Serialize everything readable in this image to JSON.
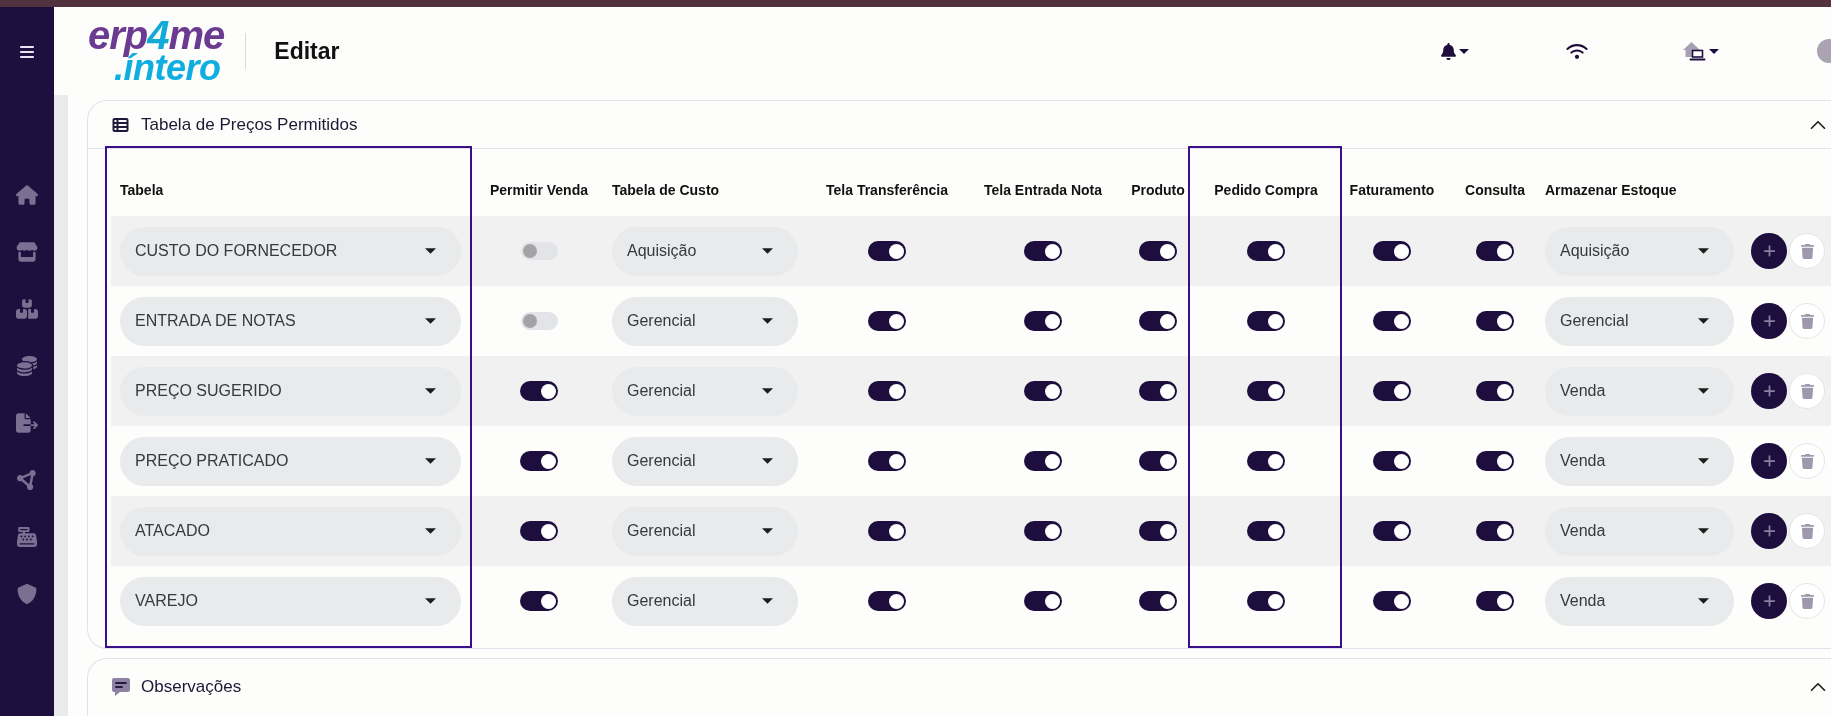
{
  "header": {
    "logo": {
      "word": "erp",
      "digit": "4",
      "suffix": "me",
      "tagline": ".íntero"
    },
    "title": "Editar"
  },
  "price_tables": {
    "title": "Tabela de Preços Permitidos",
    "expanded": true,
    "columns": [
      {
        "label": "Tabela",
        "kind": "select",
        "highlighted": true
      },
      {
        "label": "Permitir Venda",
        "kind": "toggle",
        "highlighted": false
      },
      {
        "label": "Tabela de Custo",
        "kind": "select",
        "highlighted": false
      },
      {
        "label": "Tela Transferência",
        "kind": "toggle",
        "highlighted": false
      },
      {
        "label": "Tela Entrada Nota",
        "kind": "toggle",
        "highlighted": false
      },
      {
        "label": "Produto",
        "kind": "toggle",
        "highlighted": false
      },
      {
        "label": "Pedido Compra",
        "kind": "toggle",
        "highlighted": true
      },
      {
        "label": "Faturamento",
        "kind": "toggle",
        "highlighted": false
      },
      {
        "label": "Consulta",
        "kind": "toggle",
        "highlighted": false
      },
      {
        "label": "Armazenar Estoque",
        "kind": "select",
        "highlighted": false
      }
    ],
    "rows": [
      {
        "cells": [
          {
            "value": "CUSTO DO FORNECEDOR"
          },
          {
            "on": false
          },
          {
            "value": "Aquisição"
          },
          {
            "on": true
          },
          {
            "on": true
          },
          {
            "on": true
          },
          {
            "on": true
          },
          {
            "on": true
          },
          {
            "on": true
          },
          {
            "value": "Aquisição"
          }
        ]
      },
      {
        "cells": [
          {
            "value": "ENTRADA DE NOTAS"
          },
          {
            "on": false
          },
          {
            "value": "Gerencial"
          },
          {
            "on": true
          },
          {
            "on": true
          },
          {
            "on": true
          },
          {
            "on": true
          },
          {
            "on": true
          },
          {
            "on": true
          },
          {
            "value": "Gerencial"
          }
        ]
      },
      {
        "cells": [
          {
            "value": "PREÇO SUGERIDO"
          },
          {
            "on": true
          },
          {
            "value": "Gerencial"
          },
          {
            "on": true
          },
          {
            "on": true
          },
          {
            "on": true
          },
          {
            "on": true
          },
          {
            "on": true
          },
          {
            "on": true
          },
          {
            "value": "Venda"
          }
        ]
      },
      {
        "cells": [
          {
            "value": "PREÇO PRATICADO"
          },
          {
            "on": true
          },
          {
            "value": "Gerencial"
          },
          {
            "on": true
          },
          {
            "on": true
          },
          {
            "on": true
          },
          {
            "on": true
          },
          {
            "on": true
          },
          {
            "on": true
          },
          {
            "value": "Venda"
          }
        ]
      },
      {
        "cells": [
          {
            "value": "ATACADO"
          },
          {
            "on": true
          },
          {
            "value": "Gerencial"
          },
          {
            "on": true
          },
          {
            "on": true
          },
          {
            "on": true
          },
          {
            "on": true
          },
          {
            "on": true
          },
          {
            "on": true
          },
          {
            "value": "Venda"
          }
        ]
      },
      {
        "cells": [
          {
            "value": "VAREJO"
          },
          {
            "on": true
          },
          {
            "value": "Gerencial"
          },
          {
            "on": true
          },
          {
            "on": true
          },
          {
            "on": true
          },
          {
            "on": true
          },
          {
            "on": true
          },
          {
            "on": true
          },
          {
            "value": "Venda"
          }
        ]
      }
    ]
  },
  "notes": {
    "title": "Observações",
    "expanded": true
  }
}
